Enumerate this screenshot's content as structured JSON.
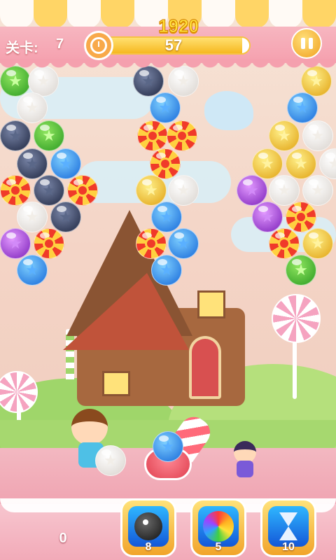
{
  "header": {
    "level_label": "关卡:",
    "level_value": "7",
    "score": "1920",
    "timer_value": "57",
    "timer_fraction": 0.95
  },
  "icons": {
    "clock": "alarm-clock-icon",
    "pause": "pause-icon",
    "bomb": "bomb-icon",
    "rainbow": "rainbow-ball-icon",
    "hourglass": "hourglass-icon"
  },
  "footer": {
    "counter": "0",
    "powerups": [
      {
        "name": "bomb",
        "count": "8"
      },
      {
        "name": "rainbow",
        "count": "5"
      },
      {
        "name": "hourglass",
        "count": "10"
      }
    ]
  },
  "colors": {
    "score_gold": "#ffe23a",
    "header_pink": "#f5a0ae",
    "powerup_blue": "#1357d8"
  }
}
